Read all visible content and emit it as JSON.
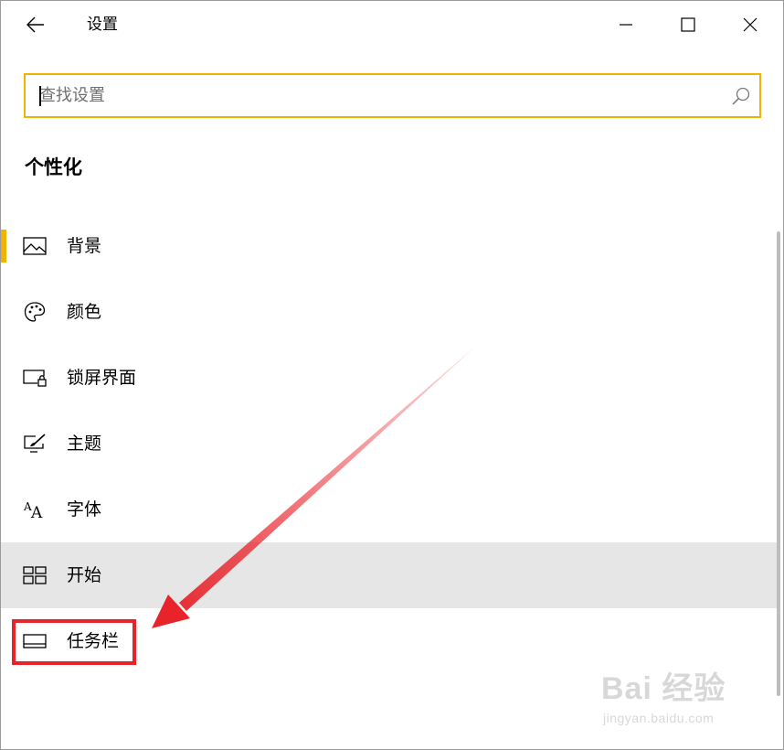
{
  "window": {
    "title": "设置",
    "icons": {
      "back": "back-arrow-icon",
      "minimize": "minimize-icon",
      "maximize": "maximize-icon",
      "close": "close-icon"
    }
  },
  "search": {
    "placeholder": "查找设置",
    "value": "",
    "icon": "search-icon"
  },
  "section_title": "个性化",
  "nav": {
    "items": [
      {
        "label": "背景",
        "icon": "picture-icon",
        "selected": true
      },
      {
        "label": "颜色",
        "icon": "palette-icon"
      },
      {
        "label": "锁屏界面",
        "icon": "lock-screen-icon"
      },
      {
        "label": "主题",
        "icon": "theme-brush-icon"
      },
      {
        "label": "字体",
        "icon": "font-icon"
      },
      {
        "label": "开始",
        "icon": "start-tiles-icon",
        "hovered": true
      },
      {
        "label": "任务栏",
        "icon": "taskbar-icon",
        "highlighted": true
      }
    ]
  },
  "colors": {
    "accent": "#f0b400",
    "hover": "#e6e6e6",
    "annotation": "#e8232a"
  },
  "watermark": {
    "brand": "Bai  经验",
    "url": "jingyan.baidu.com"
  }
}
